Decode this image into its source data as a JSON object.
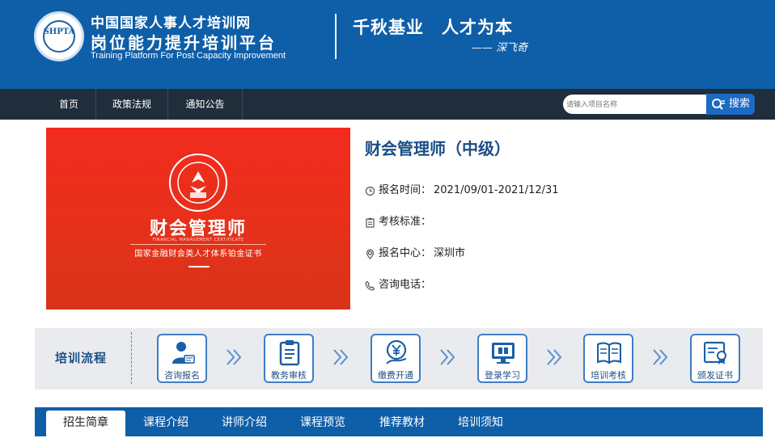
{
  "header": {
    "logo_letters": "SHPTA",
    "org_name": "中国国家人事人才培训网",
    "platform_name": "岗位能力提升培训平台",
    "platform_en": "Training Platform For Post Capacity Improvement",
    "slogan": "千秋基业　人才为本",
    "signature": "—— 深飞奇"
  },
  "nav": {
    "items": [
      "首页",
      "政策法规",
      "通知公告"
    ],
    "search_placeholder": "请输入项目名称",
    "search_button": "搜索"
  },
  "banner": {
    "title": "财会管理师",
    "en": "FINANCIAL MANAGEMENT CERTIFICATE",
    "subtitle": "国家金融财会类人才体系铂金证书",
    "emblem_icon": "certificate-emblem-icon"
  },
  "course": {
    "title": "财会管理师（中级）",
    "info": [
      {
        "label": "报名时间：",
        "value": "2021/09/01-2021/12/31",
        "icon": "clock-icon"
      },
      {
        "label": "考核标准：",
        "value": "",
        "icon": "clipboard-icon"
      },
      {
        "label": "报名中心：",
        "value": "深圳市",
        "icon": "location-icon"
      },
      {
        "label": "咨询电话：",
        "value": "",
        "icon": "phone-icon"
      }
    ]
  },
  "process": {
    "label": "培训流程",
    "steps": [
      {
        "label": "咨询报名",
        "icon": "user-card-icon"
      },
      {
        "label": "教务审核",
        "icon": "clipboard-check-icon"
      },
      {
        "label": "缴费开通",
        "icon": "yuan-coin-icon"
      },
      {
        "label": "登录学习",
        "icon": "monitor-icon"
      },
      {
        "label": "培训考核",
        "icon": "book-icon"
      },
      {
        "label": "颁发证书",
        "icon": "certificate-icon"
      }
    ]
  },
  "tabs": [
    "招生简章",
    "课程介绍",
    "讲师介绍",
    "课程预览",
    "推荐教材",
    "培训须知"
  ],
  "colors": {
    "header_blue": "#0f5ea8",
    "nav_dark": "#202d3a",
    "banner_red": "#e5311a",
    "title_blue": "#1a4e86"
  }
}
